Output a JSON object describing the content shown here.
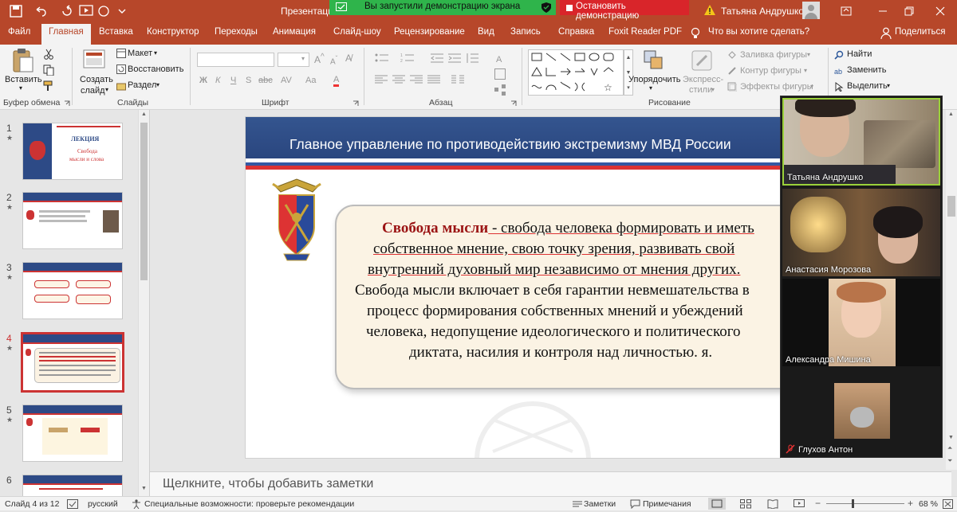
{
  "window": {
    "title": "Презентация",
    "user_name": "Татьяна Андрушко",
    "share_notice": "Вы запустили демонстрацию экрана",
    "stop_share_label": "Остановить демонстрацию"
  },
  "tabs": [
    "Файл",
    "Главная",
    "Вставка",
    "Конструктор",
    "Переходы",
    "Анимация",
    "Слайд-шоу",
    "Рецензирование",
    "Вид",
    "Запись",
    "Справка",
    "Foxit Reader PDF"
  ],
  "tell_me": "Что вы хотите сделать?",
  "share_label": "Поделиться",
  "ribbon": {
    "clipboard": {
      "paste": "Вставить",
      "group": "Буфер обмена"
    },
    "slides": {
      "new_slide_1": "Создать",
      "new_slide_2": "слайд",
      "layout": "Макет",
      "reset": "Восстановить",
      "section": "Раздел",
      "group": "Слайды"
    },
    "font": {
      "bold": "Ж",
      "italic": "К",
      "underline": "Ч",
      "strike": "S",
      "abc": "abc",
      "av": "AV",
      "aa": "Aa",
      "group": "Шрифт"
    },
    "paragraph": {
      "group": "Абзац"
    },
    "drawing": {
      "arrange": "Упорядочить",
      "styles_1": "Экспресс-",
      "styles_2": "стили",
      "fill": "Заливка фигуры",
      "outline": "Контур фигуры",
      "effects": "Эффекты фигуры",
      "group": "Рисование"
    },
    "editing": {
      "find": "Найти",
      "replace": "Заменить",
      "select": "Выделить"
    }
  },
  "thumbnails": [
    {
      "num": "1",
      "title": "ЛЕКЦИЯ",
      "sub1": "Свобода",
      "sub2": "мысли и слова"
    },
    {
      "num": "2"
    },
    {
      "num": "3"
    },
    {
      "num": "4"
    },
    {
      "num": "5"
    },
    {
      "num": "6"
    }
  ],
  "slide": {
    "header": "Главное управление по противодействию экстремизму МВД России",
    "term": "Свобода мысли",
    "line1_rest": " - свобода человека формировать и иметь",
    "line2": "собственное мнение, свою точку зрения, развивать свой",
    "line3": "внутренний духовный мир независимо от мнения других.",
    "line4": "Свобода мысли включает в себя гарантии невмешательства в",
    "line5": "процесс формирования собственных мнений и убеждений",
    "line6": "человека, недопущение идеологического и политического",
    "line7": "диктата, насилия и контроля над личностью. я."
  },
  "notes_placeholder": "Щелкните, чтобы добавить заметки",
  "participants": [
    {
      "name": "Татьяна Андрушко"
    },
    {
      "name": "Анастасия Морозова"
    },
    {
      "name": "Александра Мишина"
    },
    {
      "name": "Глухов Антон"
    }
  ],
  "status": {
    "slide_info": "Слайд 4 из 12",
    "language": "русский",
    "accessibility": "Специальные возможности: проверьте рекомендации",
    "notes": "Заметки",
    "comments": "Примечания",
    "zoom": "68 %"
  },
  "colors": {
    "accent": "#b7472a",
    "share_green": "#2fb44b",
    "stop_red": "#d9252a",
    "slide_header": "#2d4a86"
  }
}
